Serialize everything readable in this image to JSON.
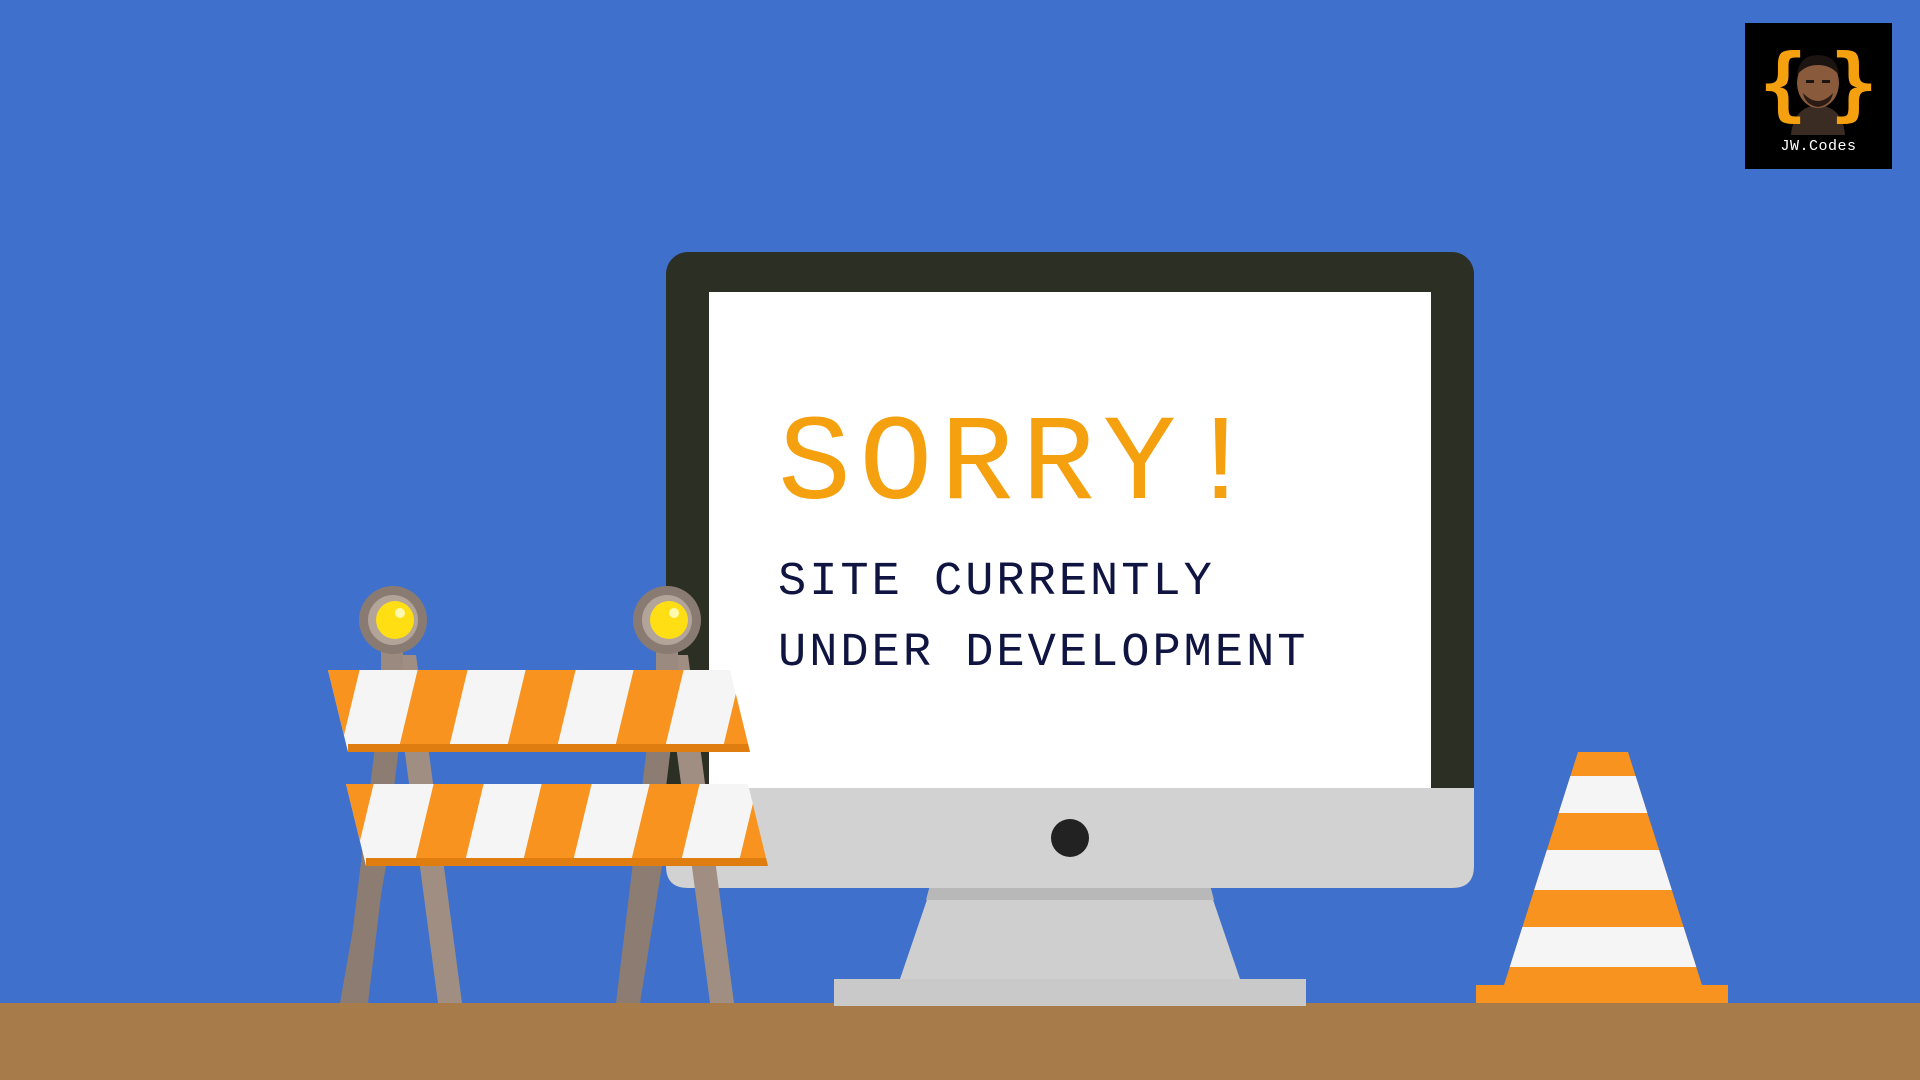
{
  "logo": {
    "text": "JW.Codes",
    "left_brace": "{",
    "right_brace": "}",
    "brace_color": "#f5a00f"
  },
  "message": {
    "heading": "SORRY!",
    "line1": "SITE CURRENTLY",
    "line2": "UNDER DEVELOPMENT"
  },
  "colors": {
    "background": "#3f70cc",
    "floor": "#a87b4b",
    "accent_orange": "#f7931e",
    "monitor_frame": "#2b2f24",
    "monitor_stand": "#d4d4d4",
    "heading_text": "#f5a00f",
    "body_text": "#0f1540"
  },
  "icons": [
    "monitor-icon",
    "barricade-icon",
    "traffic-cone-icon",
    "warning-light-icon"
  ]
}
